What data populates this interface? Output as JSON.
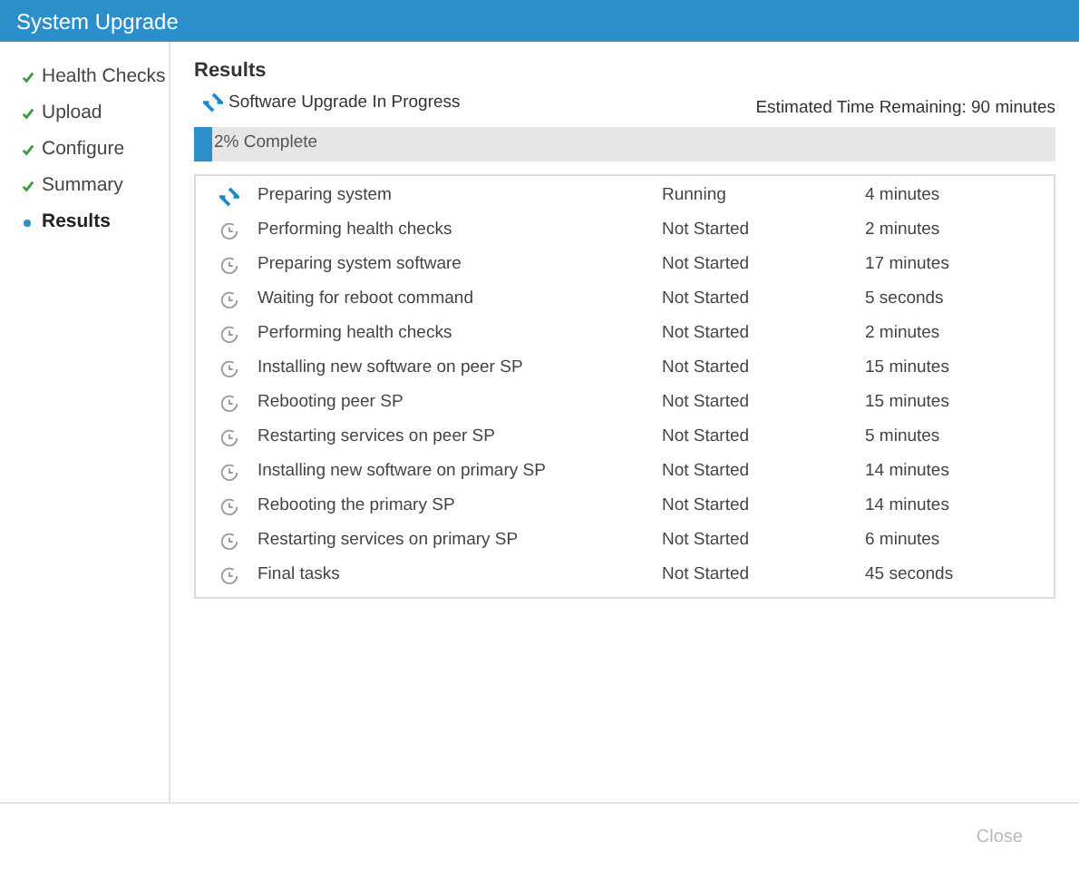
{
  "window": {
    "title": "System Upgrade"
  },
  "steps": [
    {
      "label": "Health Checks",
      "completed": true,
      "selected": false
    },
    {
      "label": "Upload",
      "completed": true,
      "selected": false
    },
    {
      "label": "Configure",
      "completed": true,
      "selected": false
    },
    {
      "label": "Summary",
      "completed": true,
      "selected": false
    },
    {
      "label": "Results",
      "completed": false,
      "selected": true
    }
  ],
  "results": {
    "heading": "Results",
    "status": "Software Upgrade In Progress",
    "time_remaining": "Estimated Time Remaining: 90 minutes",
    "progress": {
      "label": "2% Complete",
      "level": 0.02
    },
    "tasks": [
      {
        "name": "Preparing system",
        "status": "Running",
        "kind": "running",
        "duration": "4 minutes"
      },
      {
        "name": "Performing health checks",
        "status": "Not Started",
        "kind": "pending",
        "duration": "2 minutes"
      },
      {
        "name": "Preparing system software",
        "status": "Not Started",
        "kind": "pending",
        "duration": "17 minutes"
      },
      {
        "name": "Waiting for reboot command",
        "status": "Not Started",
        "kind": "pending",
        "duration": "5 seconds"
      },
      {
        "name": "Performing health checks",
        "status": "Not Started",
        "kind": "pending",
        "duration": "2 minutes"
      },
      {
        "name": "Installing new software on peer SP",
        "status": "Not Started",
        "kind": "pending",
        "duration": "15 minutes"
      },
      {
        "name": "Rebooting peer SP",
        "status": "Not Started",
        "kind": "pending",
        "duration": "15 minutes"
      },
      {
        "name": "Restarting services on peer SP",
        "status": "Not Started",
        "kind": "pending",
        "duration": "5 minutes"
      },
      {
        "name": "Installing new software on primary SP",
        "status": "Not Started",
        "kind": "pending",
        "duration": "14 minutes"
      },
      {
        "name": "Rebooting the primary SP",
        "status": "Not Started",
        "kind": "pending",
        "duration": "14 minutes"
      },
      {
        "name": "Restarting services on primary SP",
        "status": "Not Started",
        "kind": "pending",
        "duration": "6 minutes"
      },
      {
        "name": "Final tasks",
        "status": "Not Started",
        "kind": "pending",
        "duration": "45 seconds"
      }
    ]
  },
  "footer": {
    "close_button": {
      "label": "Close",
      "disabled": true
    }
  }
}
